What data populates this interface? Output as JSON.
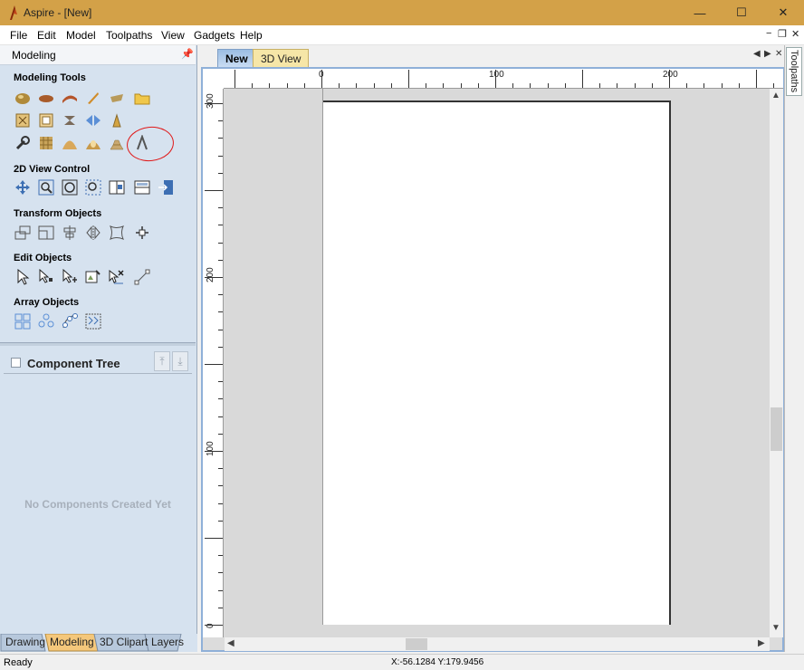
{
  "window": {
    "title": "Aspire - [New]",
    "controls": {
      "minimize": "—",
      "maximize": "☐",
      "close": "✕"
    }
  },
  "menu": {
    "items": [
      "File",
      "Edit",
      "Model",
      "Toolpaths",
      "View",
      "Gadgets",
      "Help"
    ],
    "mdi": {
      "minimize": "−",
      "restore": "❐",
      "close": "✕"
    }
  },
  "left_panel": {
    "header": "Modeling",
    "pin": "📌",
    "sections": {
      "modeling_tools": "Modeling Tools",
      "view_control": "2D View Control",
      "transform": "Transform Objects",
      "edit": "Edit Objects",
      "array": "Array Objects"
    },
    "component_tree": {
      "label": "Component Tree",
      "up": "⤒",
      "down": "⤓",
      "empty_message": "No Components Created Yet"
    },
    "bottom_tabs": [
      "Drawing",
      "Modeling",
      "3D Clipart",
      "Layers"
    ],
    "active_bottom_tab": "Modeling"
  },
  "document": {
    "tabs": [
      "New",
      "3D View"
    ],
    "active_tab": "New",
    "nav": {
      "prev": "◀",
      "next": "▶",
      "close": "✕"
    }
  },
  "rulers": {
    "horizontal_labels": [
      "0",
      "100",
      "200"
    ],
    "vertical_labels": [
      "300",
      "200",
      "100",
      "0"
    ]
  },
  "right_dock": {
    "tab": "Toolpaths"
  },
  "status": {
    "left": "Ready",
    "coords": "X:-56.1284 Y:179.9456"
  },
  "scroll": {
    "up": "▲",
    "down": "▼",
    "left": "◀",
    "right": "▶"
  },
  "colors": {
    "titlebar": "#d3a148",
    "panel_bg": "#d6e2ef",
    "active_tab": "#9bbde3",
    "annotation": "#e01919"
  }
}
